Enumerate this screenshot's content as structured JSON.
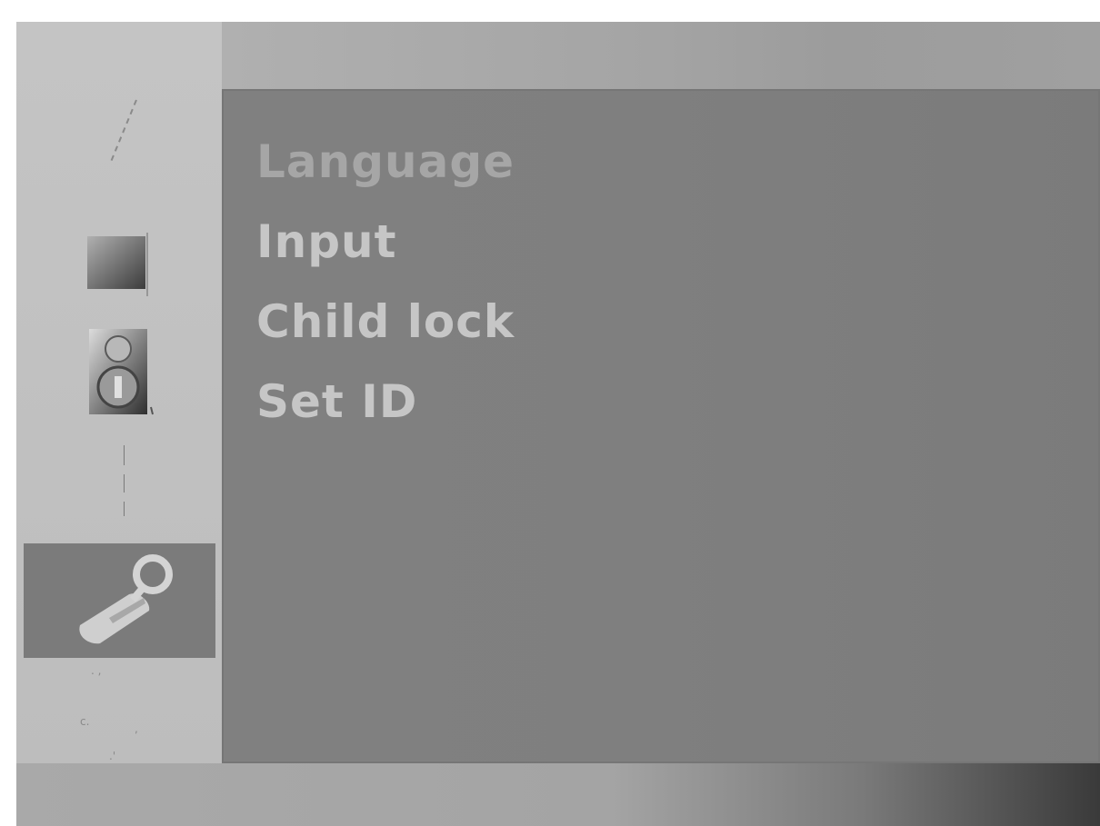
{
  "sidebar": {
    "tabs": [
      {
        "icon": "antenna-icon"
      },
      {
        "icon": "picture-icon"
      },
      {
        "icon": "speaker-icon"
      },
      {
        "icon": "clock-icon"
      },
      {
        "icon": "option-wrench-icon",
        "selected": true
      },
      {
        "icon": "screen-icon"
      }
    ]
  },
  "menu": {
    "items": [
      {
        "label": "Language"
      },
      {
        "label": "Input"
      },
      {
        "label": "Child lock"
      },
      {
        "label": "Set ID"
      }
    ]
  },
  "colors": {
    "panel": "#808080",
    "selected_tab": "#7b7b7b",
    "menu_text": "#c6c6c6",
    "menu_text_first": "#a6a6a6"
  }
}
